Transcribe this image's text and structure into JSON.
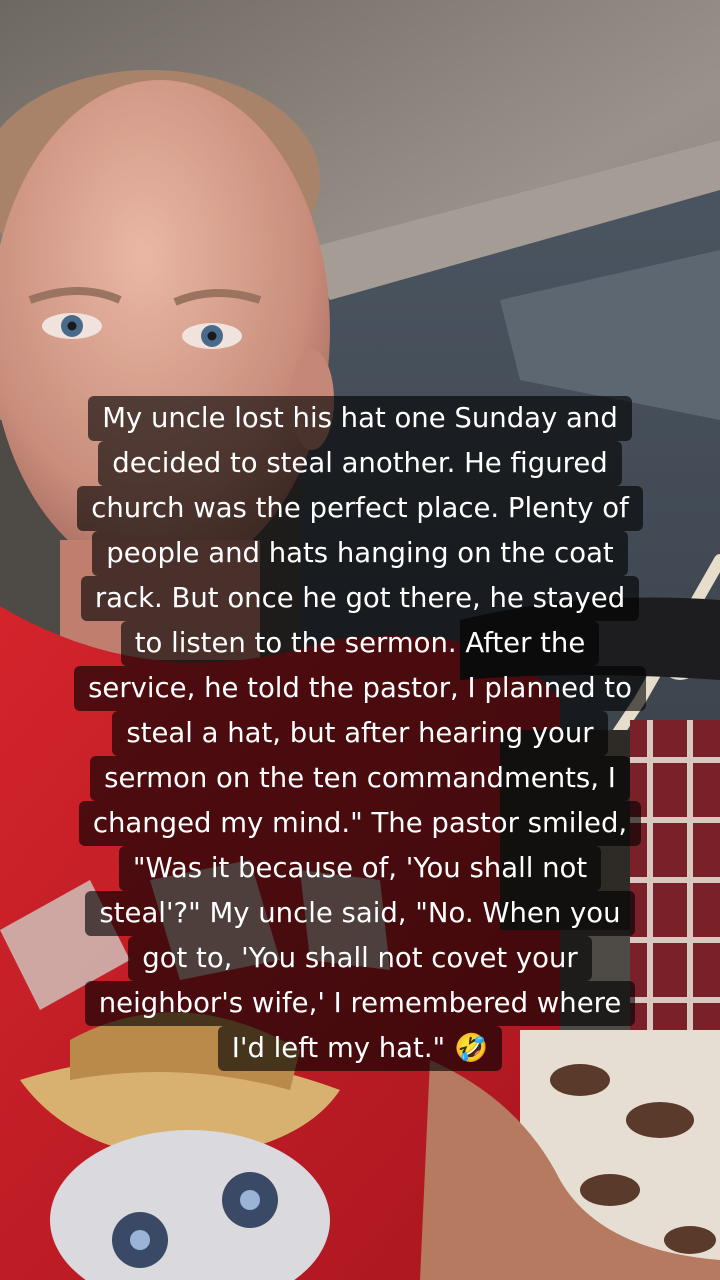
{
  "caption": {
    "lines": [
      "My uncle lost his hat one Sunday and",
      "decided to steal another. He figured",
      "church was the perfect place. Plenty of",
      "people and hats hanging on the coat",
      "rack. But once he got there, he stayed",
      "to listen to the sermon. After the",
      "service, he told the pastor, I planned to",
      "steal a hat, but after hearing your",
      "sermon on the ten commandments, I",
      "changed my mind.\" The pastor smiled,",
      "\"Was it because of, 'You shall not",
      "steal'?\" My uncle said, \"No. When you",
      "got to, 'You shall not covet your",
      "neighbor's wife,' I remembered where",
      "I'd left my hat.\" 🤣"
    ]
  },
  "colors": {
    "caption_bg": "#000000",
    "caption_text": "#ffffff",
    "shirt": "#c8202a",
    "ceiling": "#8e8780",
    "wall": "#4f5a66"
  }
}
